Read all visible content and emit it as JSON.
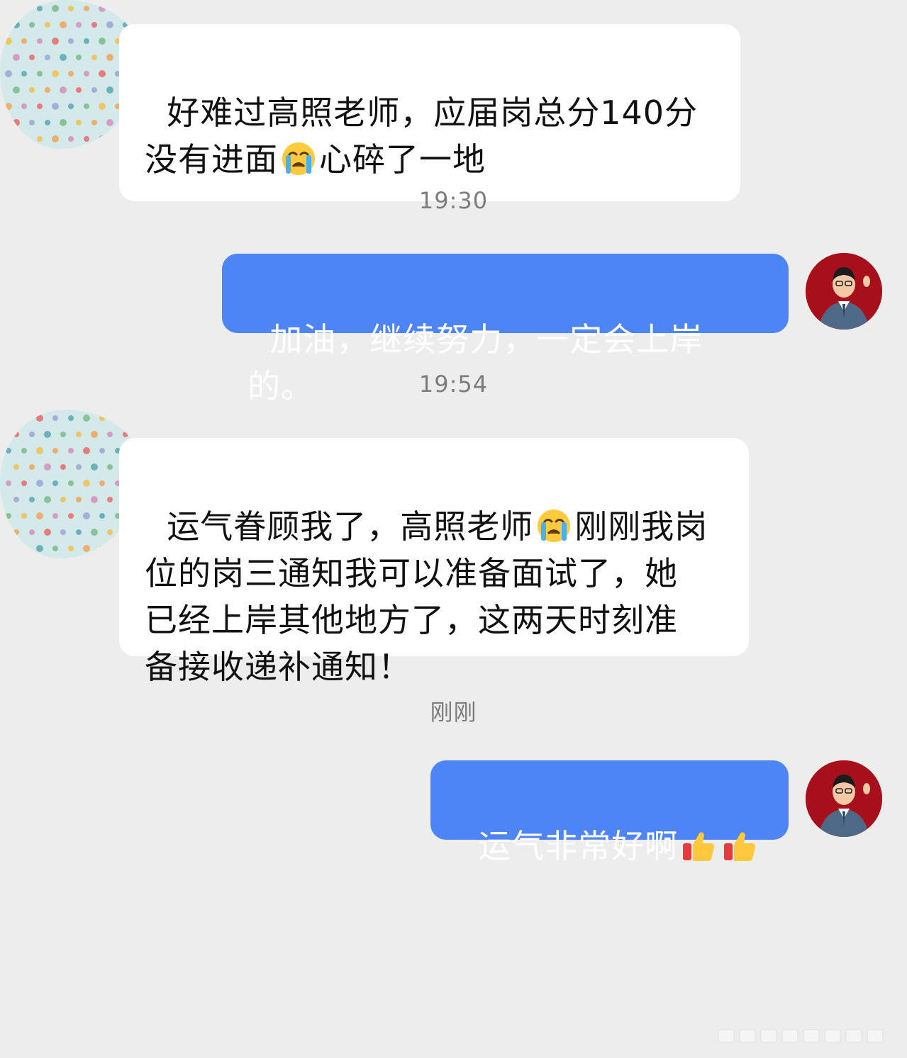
{
  "messages": [
    {
      "role": "incoming",
      "parts": [
        "好难过高照老师，应届岗总分140分\n没有进面",
        "心碎了一地"
      ],
      "emoji": [
        "loudly-crying-face"
      ]
    },
    {
      "role": "timestamp",
      "text": "19:30"
    },
    {
      "role": "outgoing",
      "parts": [
        "加油，继续努力，一定会上岸的。"
      ]
    },
    {
      "role": "timestamp",
      "text": "19:54"
    },
    {
      "role": "incoming",
      "parts": [
        "运气眷顾我了，高照老师",
        "刚刚我岗\n位的岗三通知我可以准备面试了，她\n已经上岸其他地方了，这两天时刻准\n备接收递补通知！"
      ],
      "emoji": [
        "loudly-crying-face"
      ]
    },
    {
      "role": "timestamp",
      "text": "刚刚"
    },
    {
      "role": "outgoing",
      "parts": [
        "运气非常好啊"
      ],
      "emoji": [
        "thumbs-up",
        "thumbs-up"
      ]
    }
  ],
  "colors": {
    "background": "#ededed",
    "incoming_bubble": "#ffffff",
    "outgoing_bubble": "#4d84f6",
    "timestamp_text": "#7c7c7c",
    "avatar_background": "#a7101a"
  },
  "icons": {
    "crying_emoji": "loudly-crying-face",
    "thumbs_emoji": "thumbs-up",
    "left_avatar": "polka-dot-avatar",
    "right_avatar": "man-in-suit-avatar"
  }
}
